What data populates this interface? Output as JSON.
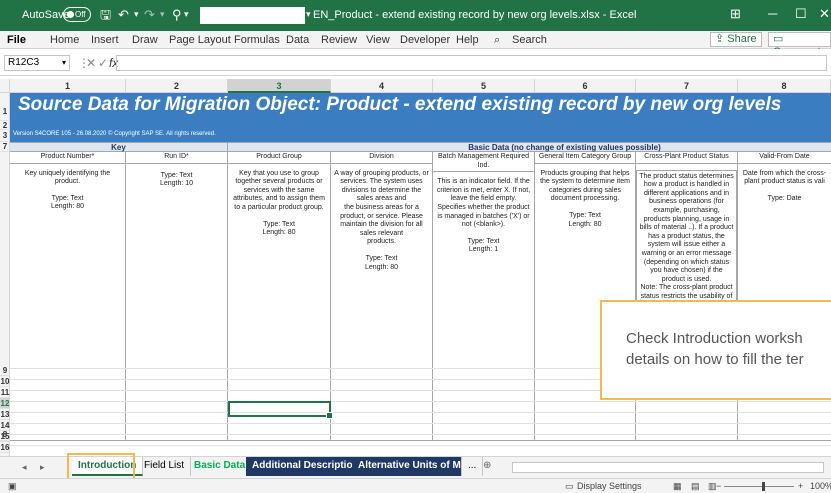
{
  "titlebar": {
    "autosave_label": "AutoSave",
    "autosave_state": "Off",
    "document_title": "EN_Product - extend existing record by new org levels.xlsx  -  Excel"
  },
  "menu": {
    "items": [
      "File",
      "Home",
      "Insert",
      "Draw",
      "Page Layout",
      "Formulas",
      "Data",
      "Review",
      "View",
      "Developer",
      "Help"
    ],
    "search_placeholder": "Search",
    "share_label": "Share",
    "comments_label": "Comments"
  },
  "formula_bar": {
    "name_box": "R12C3",
    "fx_label": "fx",
    "content": ""
  },
  "columns": [
    "1",
    "2",
    "3",
    "4",
    "5",
    "6",
    "7",
    "8"
  ],
  "selected_column": "3",
  "rows": [
    "1",
    "2",
    "3",
    "7",
    "8",
    "9",
    "10",
    "11",
    "12",
    "13",
    "14",
    "15",
    "16"
  ],
  "selected_row": "12",
  "sheet": {
    "title": "Source Data for Migration Object:  Product - extend existing record by new org levels",
    "version": "Version S4CORE 105 - 26.08.2020 © Copyright SAP SE. All rights reserved.",
    "section_key": "Key",
    "section_basic": "Basic Data (no change of existing values possible)",
    "fields": [
      {
        "name": "Product Number*",
        "desc": "Key uniquely identifying the product.",
        "type": "Type: Text",
        "length": "Length: 80"
      },
      {
        "name": "Run ID*",
        "desc": "",
        "type": "Type: Text",
        "length": "Length: 10"
      },
      {
        "name": "Product Group",
        "desc": "Key that you use to group together several products or services with the same attributes, and to assign them to a particular product group.",
        "type": "Type: Text",
        "length": "Length: 80"
      },
      {
        "name": "Division",
        "desc": "A way of grouping products, or services. The system uses divisions to determine the sales areas and\nthe business areas for a product, or service. Please maintain the division for all sales relevant\nproducts.",
        "type": "Type: Text",
        "length": "Length: 80"
      },
      {
        "name": "Batch Management Required Ind.",
        "desc": "This is an indicator field. If the criterion is met, enter X. If not, leave the field empty.\nSpecifies whether the product is managed in batches ('X') or not (<blank>).",
        "type": "Type: Text",
        "length": "Length: 1"
      },
      {
        "name": "General Item Category Group",
        "desc": "Products grouping that helps the system to determine item categories during sales document processing.",
        "type": "Type: Text",
        "length": "Length: 80"
      },
      {
        "name": "Cross-Plant Product Status",
        "desc": "The product status determines how a product is handled in different applications and in business operations (for example, purchasing, products planning, usage in bills of material ..). If a product has a product status, the system will issue either a warning or an error message (depending on which status you have chosen) if the product is used.\nNote: The cross-plant product status restricts the usability of the product for all plants. Please",
        "type": "",
        "length": ""
      },
      {
        "name": "Valid-From Date",
        "desc": "Date from which the cross-plant product status is vali",
        "type": "Type: Date",
        "length": ""
      }
    ],
    "callout_line1": "Check Introduction worksh",
    "callout_line2": "details on how to fill the ter"
  },
  "tabs": [
    "Introduction",
    "Field List",
    "Basic Data",
    "Additional Descriptions",
    "Alternative Units of Measur"
  ],
  "tabs_more": "...",
  "tabs_add": "⊕",
  "status": {
    "display_settings": "Display Settings",
    "zoom": "100%"
  },
  "colors": {
    "excel_green": "#217346",
    "banner_blue": "#3a7ec1",
    "highlight_orange": "#f2b94e",
    "dark_tab": "#1f3864"
  }
}
